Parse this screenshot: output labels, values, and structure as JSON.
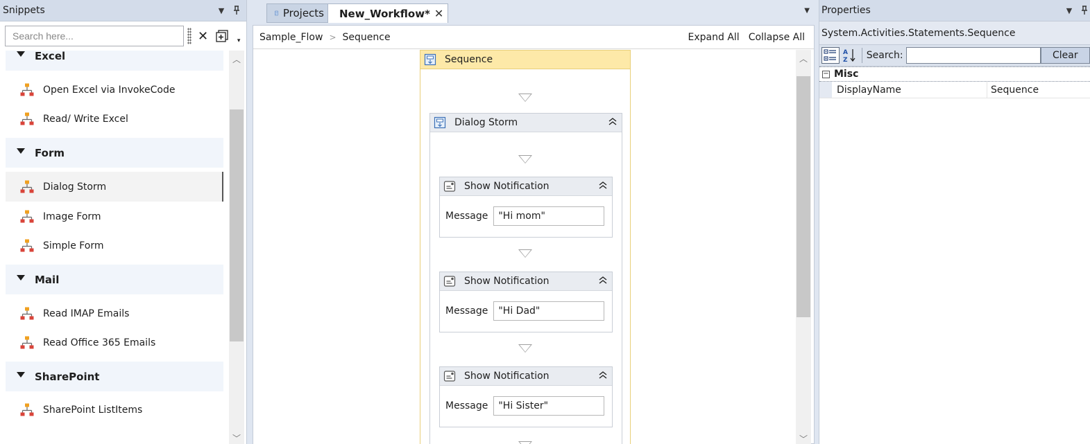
{
  "snippets": {
    "title": "Snippets",
    "search_placeholder": "Search here...",
    "groups": [
      {
        "label": "Excel",
        "items": [
          "Open Excel via InvokeCode",
          "Read/ Write Excel"
        ]
      },
      {
        "label": "Form",
        "items": [
          "Dialog Storm",
          "Image Form",
          "Simple Form"
        ]
      },
      {
        "label": "Mail",
        "items": [
          "Read IMAP Emails",
          "Read Office 365 Emails"
        ]
      },
      {
        "label": "SharePoint",
        "items": [
          "SharePoint ListItems"
        ]
      }
    ],
    "selected_item": "Dialog Storm"
  },
  "tabs": {
    "inactive_label": "Projects",
    "active_label": "New_Workflow*"
  },
  "designer": {
    "breadcrumb": [
      "Sample_Flow",
      "Sequence"
    ],
    "expand_all": "Expand All",
    "collapse_all": "Collapse All",
    "sequence_title": "Sequence",
    "inner_title": "Dialog Storm",
    "notifications": [
      {
        "title": "Show Notification",
        "label": "Message",
        "value": "\"Hi mom\""
      },
      {
        "title": "Show Notification",
        "label": "Message",
        "value": "\"Hi Dad\""
      },
      {
        "title": "Show Notification",
        "label": "Message",
        "value": "\"Hi Sister\""
      }
    ]
  },
  "properties": {
    "title": "Properties",
    "type_name": "System.Activities.Statements.Sequence",
    "search_label": "Search:",
    "clear_label": "Clear",
    "category": "Misc",
    "rows": [
      {
        "name": "DisplayName",
        "value": "Sequence"
      }
    ]
  },
  "colors": {
    "panel_header": "#d3dcea",
    "sequence_header": "#fde9a8",
    "sequence_border": "#e8cf7a",
    "activity_header": "#e9ecf1",
    "snippet_icon_red": "#d9443a",
    "snippet_icon_orange": "#f0a020"
  }
}
